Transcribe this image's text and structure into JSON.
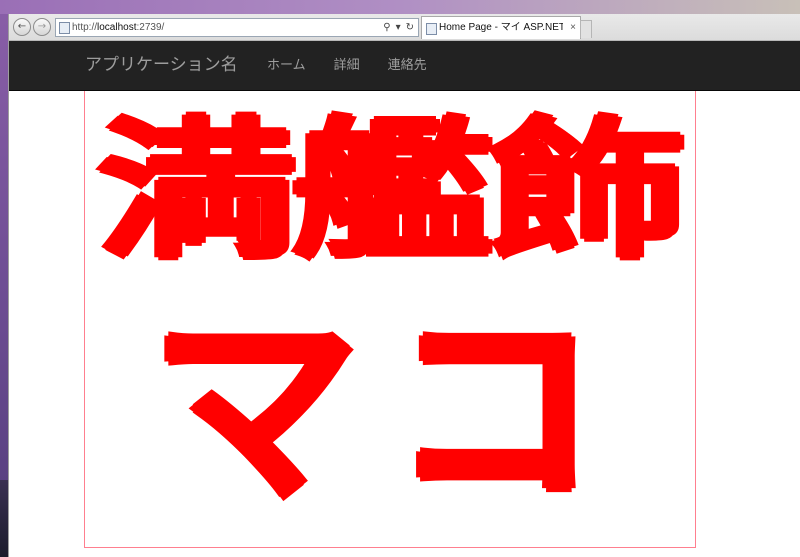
{
  "browser": {
    "url_scheme": "http://",
    "url_host": "localhost",
    "url_rest": ":2739/",
    "tab_title": "Home Page - マイ ASP.NET...",
    "tab_close": "×",
    "back_glyph": "←",
    "forward_glyph": "→",
    "search_glyph": "⚲",
    "dropdown_glyph": "▾",
    "refresh_glyph": "↻"
  },
  "navbar": {
    "brand": "アプリケーション名",
    "links": [
      "ホーム",
      "詳細",
      "連絡先"
    ]
  },
  "hero": {
    "line1": "満艦飾",
    "line2": "マコ"
  },
  "colors": {
    "navbar_bg": "#222222",
    "navbar_text": "#9d9d9d",
    "hero_text": "#ff0000",
    "hero_border": "#ff7f8f"
  }
}
